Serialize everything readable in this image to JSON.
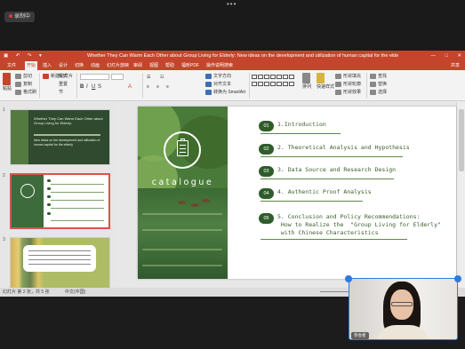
{
  "meeting": {
    "recording_label": "录制中"
  },
  "ppt": {
    "quick_access": [
      "保存",
      "撤销",
      "重做"
    ],
    "title": "Whether They Can Warm Each Other about Group Living for Elderly: New ideas on the development and utilization of human capital for the elderly",
    "window_controls": [
      "—",
      "□",
      "✕"
    ],
    "menu_tabs": [
      "文件",
      "开始",
      "插入",
      "设计",
      "切换",
      "动画",
      "幻灯片放映",
      "审阅",
      "视图",
      "帮助",
      "福昕PDF",
      "操作说明搜索"
    ],
    "active_tab_index": 1,
    "share_label": "共享",
    "ribbon": {
      "paste": "粘贴",
      "cut": "剪切",
      "copy": "复制",
      "format_painter": "格式刷",
      "new_slide": "新建幻灯片",
      "layout": "版式",
      "reset": "重置",
      "section": "节",
      "text_direction": "文字方向",
      "align_text": "对齐文本",
      "convert_smartart": "转换为 SmartArt",
      "arrange": "排列",
      "quick_styles": "快速样式",
      "shape_fill": "形状填充",
      "shape_outline": "形状轮廓",
      "shape_effects": "形状效果",
      "find": "查找",
      "replace": "替换",
      "select": "选择"
    },
    "thumbnails": [
      {
        "number": "1",
        "title": "Whether They Can Warm Each Other about Group Living for Elderly:",
        "subtitle": "New ideas on the development and utilization of human capital for the elderly"
      },
      {
        "number": "2",
        "items": [
          "Introduction",
          "Theoretical Analysis and Hypothesis",
          "Data Source and Research Design",
          "Authentic Proof Analysis",
          "Conclusion and Policy Recommendations"
        ]
      },
      {
        "number": "3"
      }
    ],
    "slide": {
      "heading": "catalogue",
      "items": [
        {
          "badge": "01",
          "text": "1.Introduction"
        },
        {
          "badge": "02",
          "text": "2. Theoretical Analysis and Hypothesis"
        },
        {
          "badge": "03",
          "text": "3. Data Source and Research Design"
        },
        {
          "badge": "04",
          "text": "4. Authentic Proof Analysis"
        },
        {
          "badge": "05",
          "text": "5. Conclusion and Policy Recommendations:\n How to Realize the  \"Group Living for Elderly\"\n with Chinese Characteristics"
        }
      ]
    },
    "status": {
      "slide_info": "幻灯片 第 2 张，共 5 张",
      "language": "中文(中国)"
    }
  },
  "webcam": {
    "name_label": "参会者"
  }
}
